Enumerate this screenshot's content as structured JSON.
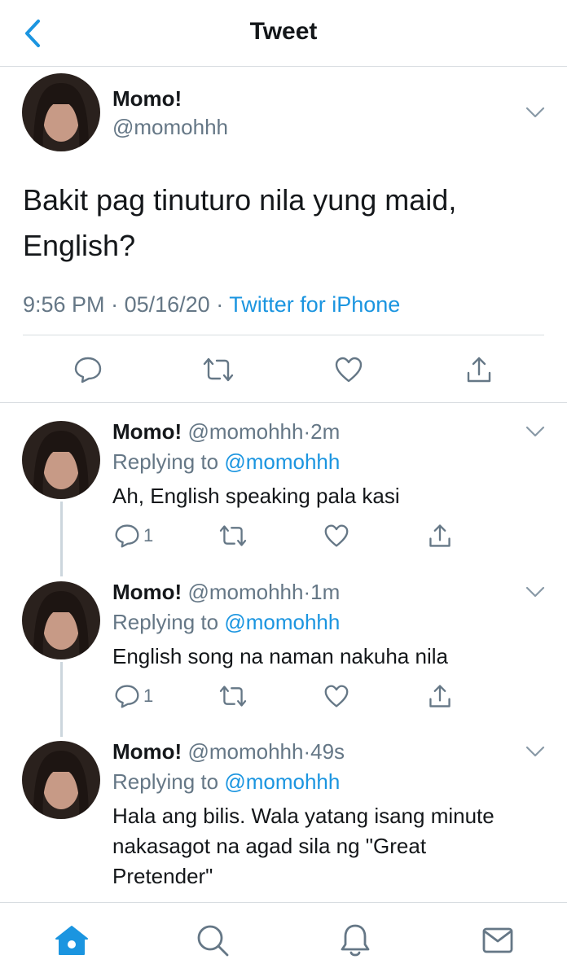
{
  "nav": {
    "title": "Tweet"
  },
  "main_tweet": {
    "author_name": "Momo!",
    "author_handle": "@momohhh",
    "text_line1": "Bakit pag tinuturo nila yung maid,",
    "text_line2": "English?",
    "time": "9:56 PM",
    "separator": "·",
    "date": "05/16/20",
    "source": "Twitter for iPhone"
  },
  "replies": [
    {
      "name": "Momo!",
      "handle": "@momohhh",
      "dot": "·",
      "time": "2m",
      "replying_label": "Replying to",
      "replying_to": "@momohhh",
      "text": "Ah, English speaking pala kasi",
      "reply_count": "1"
    },
    {
      "name": "Momo!",
      "handle": "@momohhh",
      "dot": "·",
      "time": "1m",
      "replying_label": "Replying to",
      "replying_to": "@momohhh",
      "text": "English song na naman nakuha nila",
      "reply_count": "1"
    },
    {
      "name": "Momo!",
      "handle": "@momohhh",
      "dot": "·",
      "time": "49s",
      "replying_label": "Replying to",
      "replying_to": "@momohhh",
      "text_line1": "Hala ang bilis. Wala yatang isang minute",
      "text_line2": "nakasagot na agad sila ng \"Great",
      "text_line3": "Pretender\""
    }
  ],
  "colors": {
    "accent": "#1b95e0",
    "secondary_text": "#657786",
    "divider": "#d8dde1"
  },
  "icons": {
    "nav": "chevron-left-icon",
    "tweet_menu": "chevron-down-icon",
    "actions": [
      "reply-icon",
      "retweet-icon",
      "like-icon",
      "share-icon"
    ],
    "tabs": [
      "home-icon",
      "search-icon",
      "notifications-icon",
      "messages-icon"
    ]
  }
}
